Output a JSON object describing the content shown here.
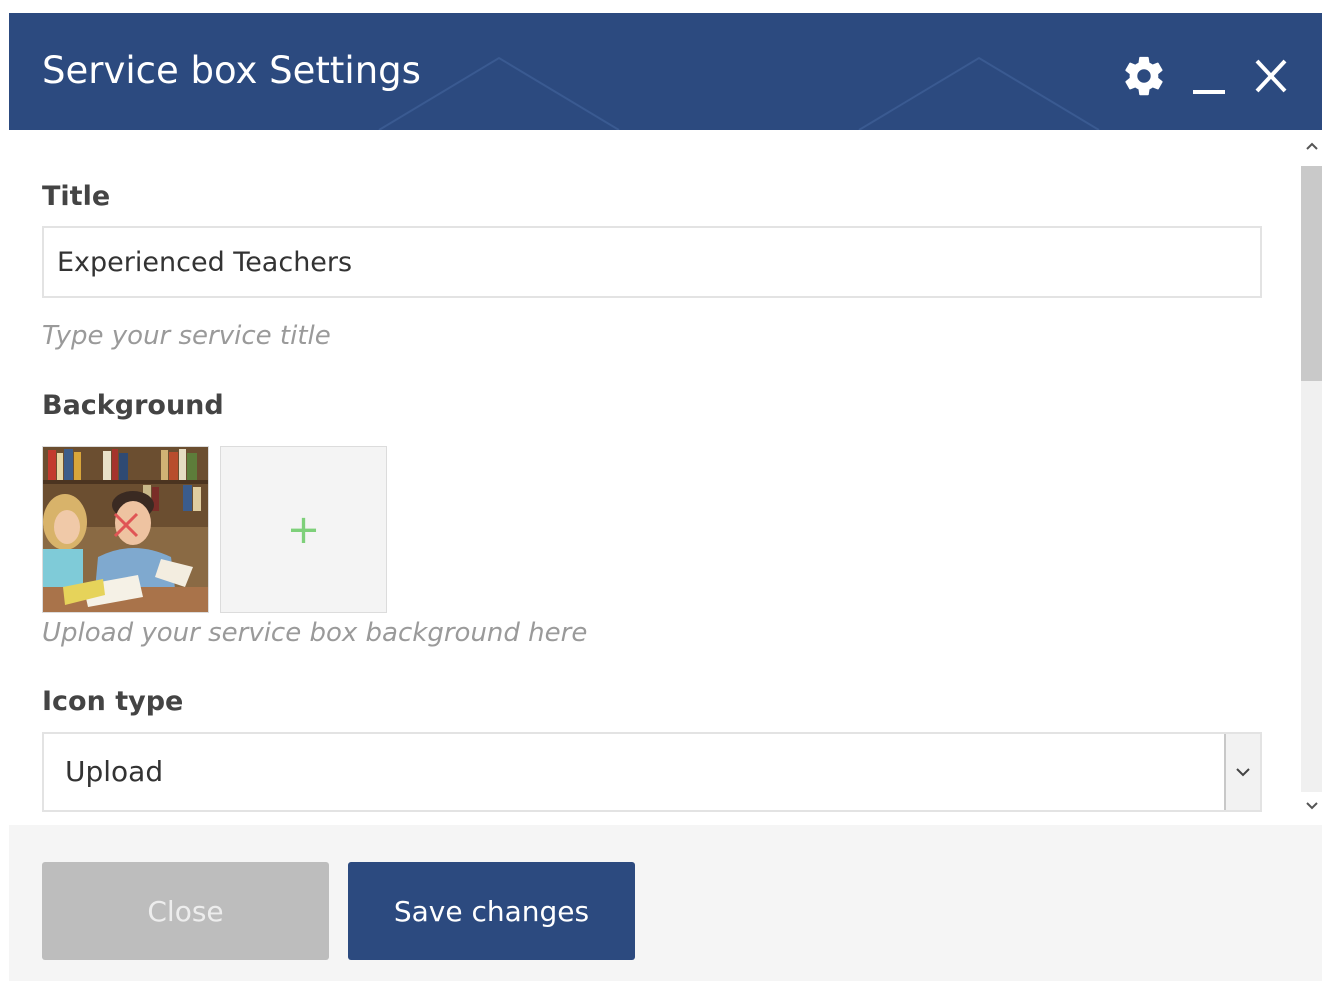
{
  "dialog": {
    "title": "Service box Settings"
  },
  "header_icons": {
    "settings": "gear-icon",
    "minimize": "minimize-icon",
    "close": "close-icon"
  },
  "fields": {
    "title": {
      "label": "Title",
      "value": "Experienced Teachers",
      "help": "Type your service title"
    },
    "background": {
      "label": "Background",
      "image_alt": "students reading books in library",
      "add_symbol": "+",
      "help": "Upload your service box background here"
    },
    "icon_type": {
      "label": "Icon type",
      "selected": "Upload"
    }
  },
  "footer": {
    "close_label": "Close",
    "save_label": "Save changes"
  },
  "colors": {
    "header": "#2c4a7f",
    "primary_button": "#2c4a7f",
    "disabled_button": "#bdbdbd",
    "plus": "#7ed07a",
    "remove": "#e05555"
  }
}
